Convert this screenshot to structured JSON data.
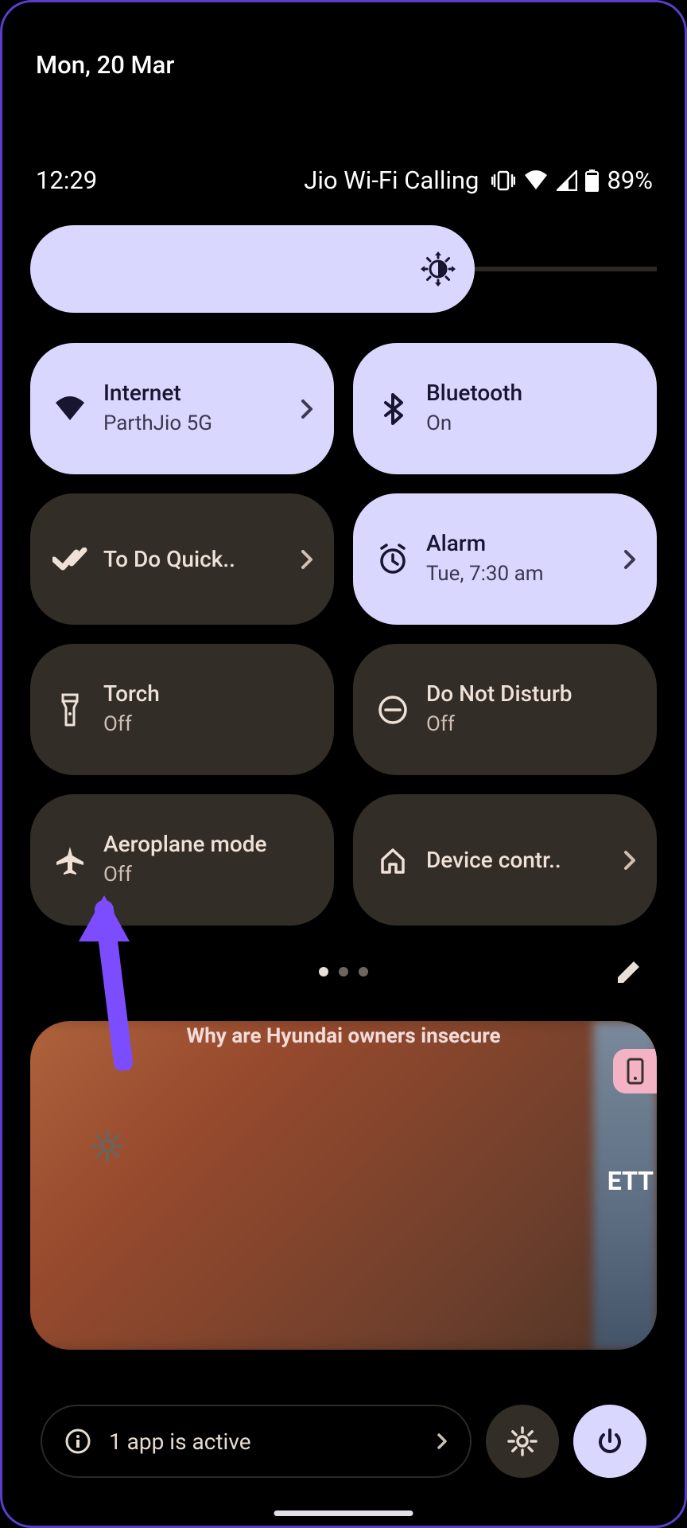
{
  "date": "Mon, 20 Mar",
  "status": {
    "time": "12:29",
    "carrier": "Jio Wi-Fi Calling",
    "battery_pct": "89%"
  },
  "tiles": {
    "internet": {
      "title": "Internet",
      "subtitle": "ParthJio 5G"
    },
    "bluetooth": {
      "title": "Bluetooth",
      "subtitle": "On"
    },
    "todo": {
      "title": "To Do Quick.."
    },
    "alarm": {
      "title": "Alarm",
      "subtitle": "Tue, 7:30 am"
    },
    "torch": {
      "title": "Torch",
      "subtitle": "Off"
    },
    "dnd": {
      "title": "Do Not Disturb",
      "subtitle": "Off"
    },
    "airplane": {
      "title": "Aeroplane mode",
      "subtitle": "Off"
    },
    "device": {
      "title": "Device contr.."
    }
  },
  "notification": {
    "headline": "Why are Hyundai owners insecure",
    "partial_text": "ETT"
  },
  "footer": {
    "active_apps": "1 app is active"
  }
}
